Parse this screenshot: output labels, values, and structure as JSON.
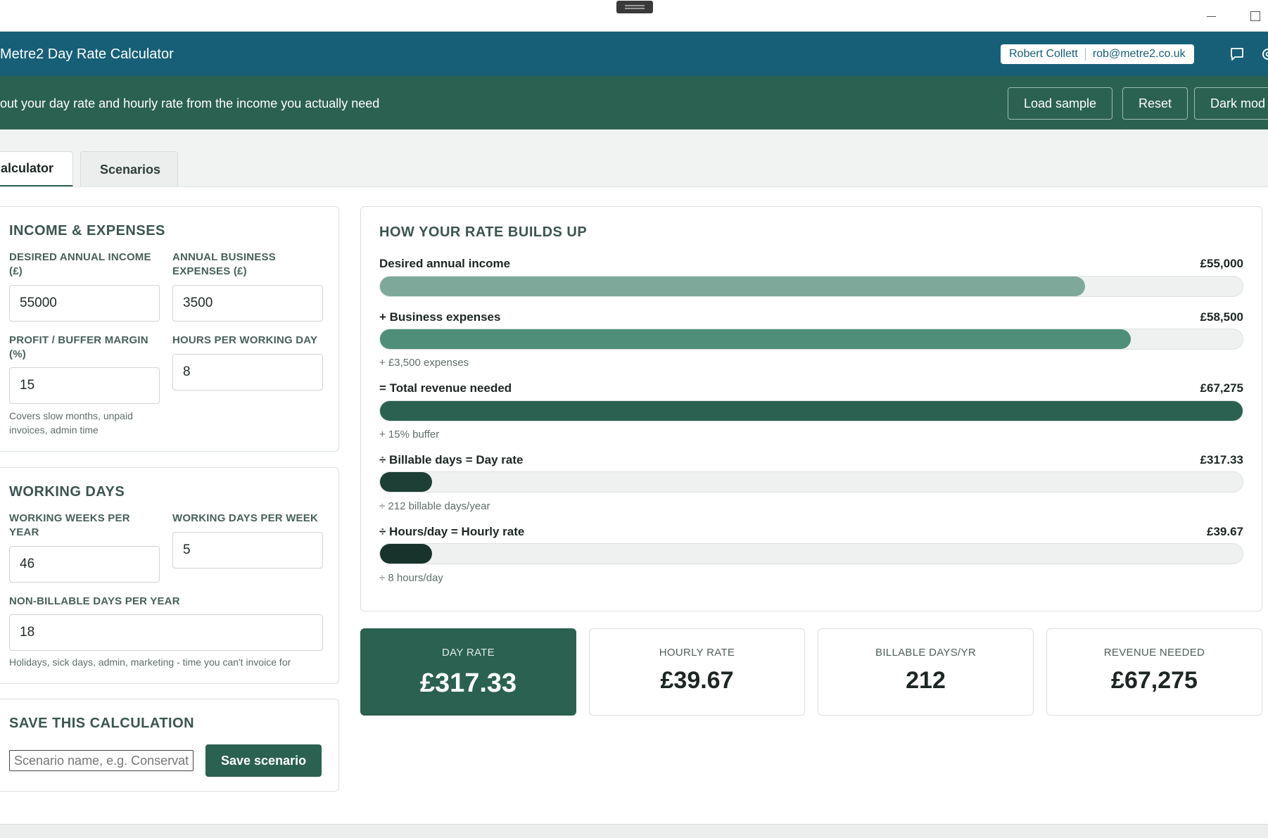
{
  "app": {
    "title": "Metre2 Day Rate Calculator",
    "user_name": "Robert Collett",
    "user_email": "rob@metre2.co.uk"
  },
  "banner": {
    "text": "out your day rate and hourly rate from the income you actually need",
    "buttons": {
      "load_sample": "Load sample",
      "reset": "Reset",
      "dark_mode": "Dark mod"
    }
  },
  "tabs": [
    {
      "label": "alculator",
      "active": true
    },
    {
      "label": "Scenarios",
      "active": false
    }
  ],
  "income": {
    "title": "INCOME & EXPENSES",
    "desired_income_label": "DESIRED ANNUAL INCOME (£)",
    "desired_income_value": "55000",
    "expenses_label": "ANNUAL BUSINESS EXPENSES (£)",
    "expenses_value": "3500",
    "margin_label": "PROFIT / BUFFER MARGIN (%)",
    "margin_value": "15",
    "margin_help": "Covers slow months, unpaid invoices, admin time",
    "hours_label": "HOURS PER WORKING DAY",
    "hours_value": "8"
  },
  "working_days": {
    "title": "WORKING DAYS",
    "weeks_label": "WORKING WEEKS PER YEAR",
    "weeks_value": "46",
    "days_label": "WORKING DAYS PER WEEK",
    "days_value": "5",
    "nonbillable_label": "NON-BILLABLE DAYS PER YEAR",
    "nonbillable_value": "18",
    "nonbillable_help": "Holidays, sick days, admin, marketing - time you can't invoice for"
  },
  "save": {
    "title": "SAVE THIS CALCULATION",
    "placeholder": "Scenario name, e.g. Conservative",
    "button": "Save scenario"
  },
  "buildup": {
    "title": "HOW YOUR RATE BUILDS UP",
    "rows": [
      {
        "label": "Desired annual income",
        "value": "£55,000",
        "note": "",
        "fill_fraction": 0.817,
        "color": "#7ea89a"
      },
      {
        "label": "+ Business expenses",
        "value": "£58,500",
        "note": "+ £3,500 expenses",
        "fill_fraction": 0.87,
        "color": "#4f8e78"
      },
      {
        "label": "= Total revenue needed",
        "value": "£67,275",
        "note": "+ 15% buffer",
        "fill_fraction": 1.0,
        "color": "#2b6150"
      },
      {
        "label": "÷ Billable days = Day rate",
        "value": "£317.33",
        "note": "÷ 212 billable days/year",
        "fill_fraction": 0.06,
        "color": "#1d3f36"
      },
      {
        "label": "÷ Hours/day = Hourly rate",
        "value": "£39.67",
        "note": "÷ 8 hours/day",
        "fill_fraction": 0.06,
        "color": "#18332c"
      }
    ]
  },
  "stats": [
    {
      "label": "DAY RATE",
      "value": "£317.33",
      "primary": true
    },
    {
      "label": "HOURLY RATE",
      "value": "£39.67",
      "primary": false
    },
    {
      "label": "BILLABLE DAYS/YR",
      "value": "212",
      "primary": false
    },
    {
      "label": "REVENUE NEEDED",
      "value": "£67,275",
      "primary": false
    }
  ],
  "colors": {
    "header": "#175f77",
    "banner": "#2b6150",
    "accent": "#2b6150"
  },
  "icons": [
    "chat-icon",
    "gear-icon",
    "minimize-icon",
    "maximize-icon"
  ]
}
